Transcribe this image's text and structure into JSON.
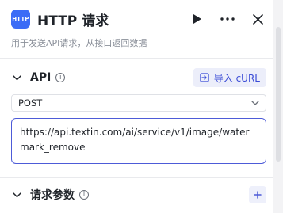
{
  "header": {
    "app_icon_text": "HTTP",
    "title": "HTTP 请求",
    "subtitle": "用于发送API请求，从接口返回数据"
  },
  "api_section": {
    "title": "API",
    "import_label": "导入 cURL",
    "method": "POST",
    "url": "https://api.textin.com/ai/service/v1/image/watermark_remove"
  },
  "params_section": {
    "title": "请求参数"
  },
  "icons": {
    "run": "play-icon",
    "more": "more-dots-icon",
    "close": "close-icon",
    "info": "info-icon",
    "import": "import-icon",
    "chevron": "chevron-down-icon",
    "add": "plus-icon"
  },
  "colors": {
    "accent": "#4d5bd8",
    "app_icon": "#3b6cf6"
  }
}
